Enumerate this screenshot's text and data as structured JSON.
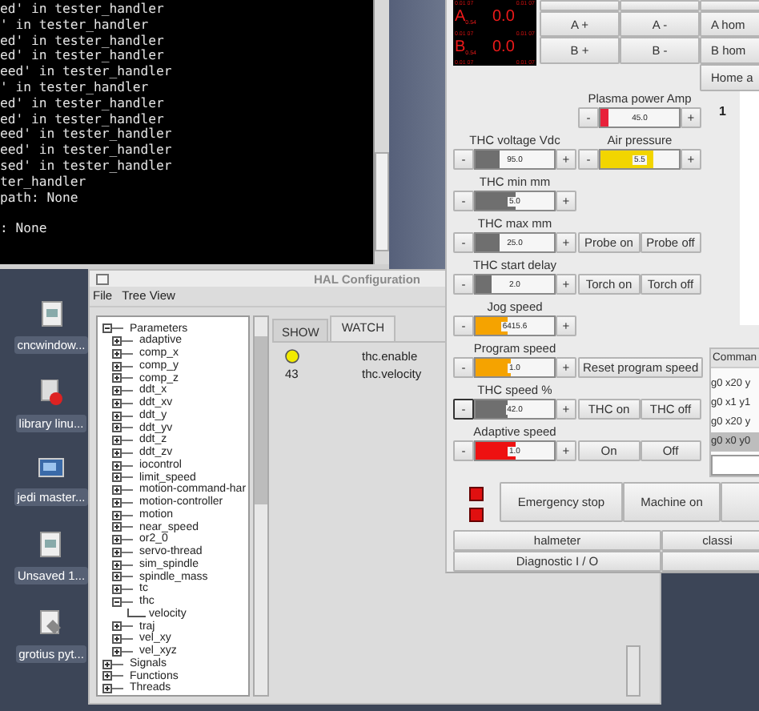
{
  "terminal": {
    "blocks": [
      [
        "ed' in tester_handler",
        "' in tester_handler",
        "ed' in tester_handler",
        "ed' in tester_handler",
        "eed' in tester_handler",
        "' in tester_handler",
        "ed' in tester_handler",
        "ed' in tester_handler",
        "eed' in tester_handler",
        "eed' in tester_handler",
        "sed' in tester_handler",
        "ter_handler",
        "path: None"
      ],
      [
        ": None"
      ]
    ]
  },
  "desktop_icons": [
    {
      "label": "cncwindow...",
      "kind": "file"
    },
    {
      "label": "library linu...",
      "kind": "package"
    },
    {
      "label": "jedi master...",
      "kind": "screen"
    },
    {
      "label": "Unsaved 1...",
      "kind": "file"
    },
    {
      "label": "grotius pyt...",
      "kind": "tool"
    }
  ],
  "hal_window": {
    "title": "HAL Configuration",
    "menu": [
      "File",
      "Tree View"
    ],
    "tree": [
      {
        "label": "Parameters",
        "expanded": true,
        "children": [
          {
            "label": "adaptive",
            "expanded": false
          },
          {
            "label": "comp_x",
            "expanded": false
          },
          {
            "label": "comp_y",
            "expanded": false
          },
          {
            "label": "comp_z",
            "expanded": false
          },
          {
            "label": "ddt_x",
            "expanded": false
          },
          {
            "label": "ddt_xv",
            "expanded": false
          },
          {
            "label": "ddt_y",
            "expanded": false
          },
          {
            "label": "ddt_yv",
            "expanded": false
          },
          {
            "label": "ddt_z",
            "expanded": false
          },
          {
            "label": "ddt_zv",
            "expanded": false
          },
          {
            "label": "iocontrol",
            "expanded": false
          },
          {
            "label": "limit_speed",
            "expanded": false
          },
          {
            "label": "motion-command-har",
            "expanded": false
          },
          {
            "label": "motion-controller",
            "expanded": false
          },
          {
            "label": "motion",
            "expanded": false
          },
          {
            "label": "near_speed",
            "expanded": false
          },
          {
            "label": "or2_0",
            "expanded": false
          },
          {
            "label": "servo-thread",
            "expanded": false
          },
          {
            "label": "sim_spindle",
            "expanded": false
          },
          {
            "label": "spindle_mass",
            "expanded": false
          },
          {
            "label": "tc",
            "expanded": false
          },
          {
            "label": "thc",
            "expanded": true,
            "children": [
              {
                "label": "velocity"
              }
            ]
          },
          {
            "label": "traj",
            "expanded": false
          },
          {
            "label": "vel_xy",
            "expanded": false
          },
          {
            "label": "vel_xyz",
            "expanded": false
          }
        ]
      },
      {
        "label": "Signals",
        "expanded": false
      },
      {
        "label": "Functions",
        "expanded": false
      },
      {
        "label": "Threads",
        "expanded": false
      }
    ],
    "tabs": [
      {
        "label": "SHOW",
        "selected": false
      },
      {
        "label": "WATCH",
        "selected": true
      }
    ],
    "watch": [
      {
        "kind": "led",
        "on": true,
        "name": "thc.enable"
      },
      {
        "kind": "number",
        "value": "43",
        "name": "thc.velocity"
      }
    ]
  },
  "control_panel": {
    "dro": [
      {
        "kind": "marks",
        "texts": [
          "0.01 07",
          "0.01 07"
        ]
      },
      {
        "kind": "axis",
        "axis": "A",
        "sub": "0.54",
        "value": "0.0"
      },
      {
        "kind": "marks",
        "texts": [
          "0.01 07",
          "0.01 07"
        ]
      },
      {
        "kind": "axis",
        "axis": "B",
        "sub": "0.54",
        "value": "0.0"
      },
      {
        "kind": "marks",
        "texts": [
          "0.01 07",
          "0.01 07"
        ]
      }
    ],
    "jog_grid": [
      [
        {
          "kind": "blank"
        },
        {
          "kind": "blank"
        },
        {
          "kind": "blank"
        }
      ],
      [
        {
          "kind": "button",
          "label": "A +"
        },
        {
          "kind": "button",
          "label": "A -"
        },
        {
          "kind": "button",
          "label": "A hom"
        }
      ],
      [
        {
          "kind": "button",
          "label": "B +"
        },
        {
          "kind": "button",
          "label": "B -"
        },
        {
          "kind": "button",
          "label": "B hom"
        }
      ],
      [
        {
          "kind": "none"
        },
        {
          "kind": "none"
        },
        {
          "kind": "button",
          "label": "Home a"
        }
      ]
    ],
    "rows": [
      [
        {
          "kind": "none"
        },
        {
          "kind": "slider",
          "label": "Plasma power Amp",
          "dec": "-",
          "value": "45.0",
          "inc": "+",
          "level": 0.1,
          "color": "#e8213a",
          "focused": false
        }
      ],
      [
        {
          "kind": "slider",
          "label": "THC voltage Vdc",
          "dec": "-",
          "value": "95.0",
          "inc": "+",
          "level": 0.3,
          "color": "#6f6f6f",
          "focused": false
        },
        {
          "kind": "slider",
          "label": "Air pressure",
          "dec": "-",
          "value": "5.5",
          "inc": "+",
          "level": 0.68,
          "color": "#f2d500",
          "focused": false
        }
      ],
      [
        {
          "kind": "slider",
          "label": "THC min mm",
          "dec": "-",
          "value": "5.0",
          "inc": "+",
          "level": 0.5,
          "color": "#6f6f6f",
          "focused": false
        },
        {
          "kind": "none"
        }
      ],
      [
        {
          "kind": "slider",
          "label": "THC max mm",
          "dec": "-",
          "value": "25.0",
          "inc": "+",
          "level": 0.3,
          "color": "#6f6f6f",
          "focused": false
        },
        {
          "kind": "buttons",
          "buttons": [
            "Probe on",
            "Probe off"
          ]
        }
      ],
      [
        {
          "kind": "slider",
          "label": "THC start delay",
          "dec": "-",
          "value": "2.0",
          "inc": "+",
          "level": 0.2,
          "color": "#6f6f6f",
          "focused": false
        },
        {
          "kind": "buttons",
          "buttons": [
            "Torch on",
            "Torch off"
          ]
        }
      ],
      [
        {
          "kind": "slider",
          "label": "Jog speed",
          "dec": "-",
          "value": "6415.6",
          "inc": "+",
          "level": 0.4,
          "color": "#f5a300",
          "focused": false
        },
        {
          "kind": "none"
        }
      ],
      [
        {
          "kind": "slider",
          "label": "Program speed",
          "dec": "-",
          "value": "1.0",
          "inc": "+",
          "level": 0.45,
          "color": "#f5a300",
          "focused": false
        },
        {
          "kind": "buttons",
          "buttons": [
            "Reset program speed"
          ]
        }
      ],
      [
        {
          "kind": "slider",
          "label": "THC speed %",
          "dec": "-",
          "value": "42.0",
          "inc": "+",
          "level": 0.4,
          "color": "#6f6f6f",
          "focused": true
        },
        {
          "kind": "buttons",
          "buttons": [
            "THC on",
            "THC off"
          ]
        }
      ],
      [
        {
          "kind": "slider",
          "label": "Adaptive speed",
          "dec": "-",
          "value": "1.0",
          "inc": "+",
          "level": 0.5,
          "color": "#ee1111",
          "focused": false
        },
        {
          "kind": "buttons",
          "buttons": [
            "On",
            "Off"
          ]
        }
      ]
    ],
    "counter": "1",
    "commands": {
      "header": "Comman",
      "items": [
        {
          "text": "g0 x20 y",
          "selected": false
        },
        {
          "text": "g0 x1 y1",
          "selected": false
        },
        {
          "text": "g0 x20 y",
          "selected": false
        },
        {
          "text": "g0 x0 y0",
          "selected": true
        }
      ]
    },
    "indicators": [
      {
        "color": "#e01010"
      },
      {
        "color": "#e01010"
      }
    ],
    "machine_buttons": [
      {
        "kind": "button",
        "label": "Emergency stop"
      },
      {
        "kind": "button",
        "label": "Machine on"
      },
      {
        "kind": "blank"
      }
    ],
    "tool_buttons": [
      {
        "kind": "button",
        "label": "halmeter"
      },
      {
        "kind": "button",
        "label": "classi"
      },
      {
        "kind": "button",
        "label": "Diagnostic I / O"
      },
      {
        "kind": "blank"
      }
    ]
  }
}
